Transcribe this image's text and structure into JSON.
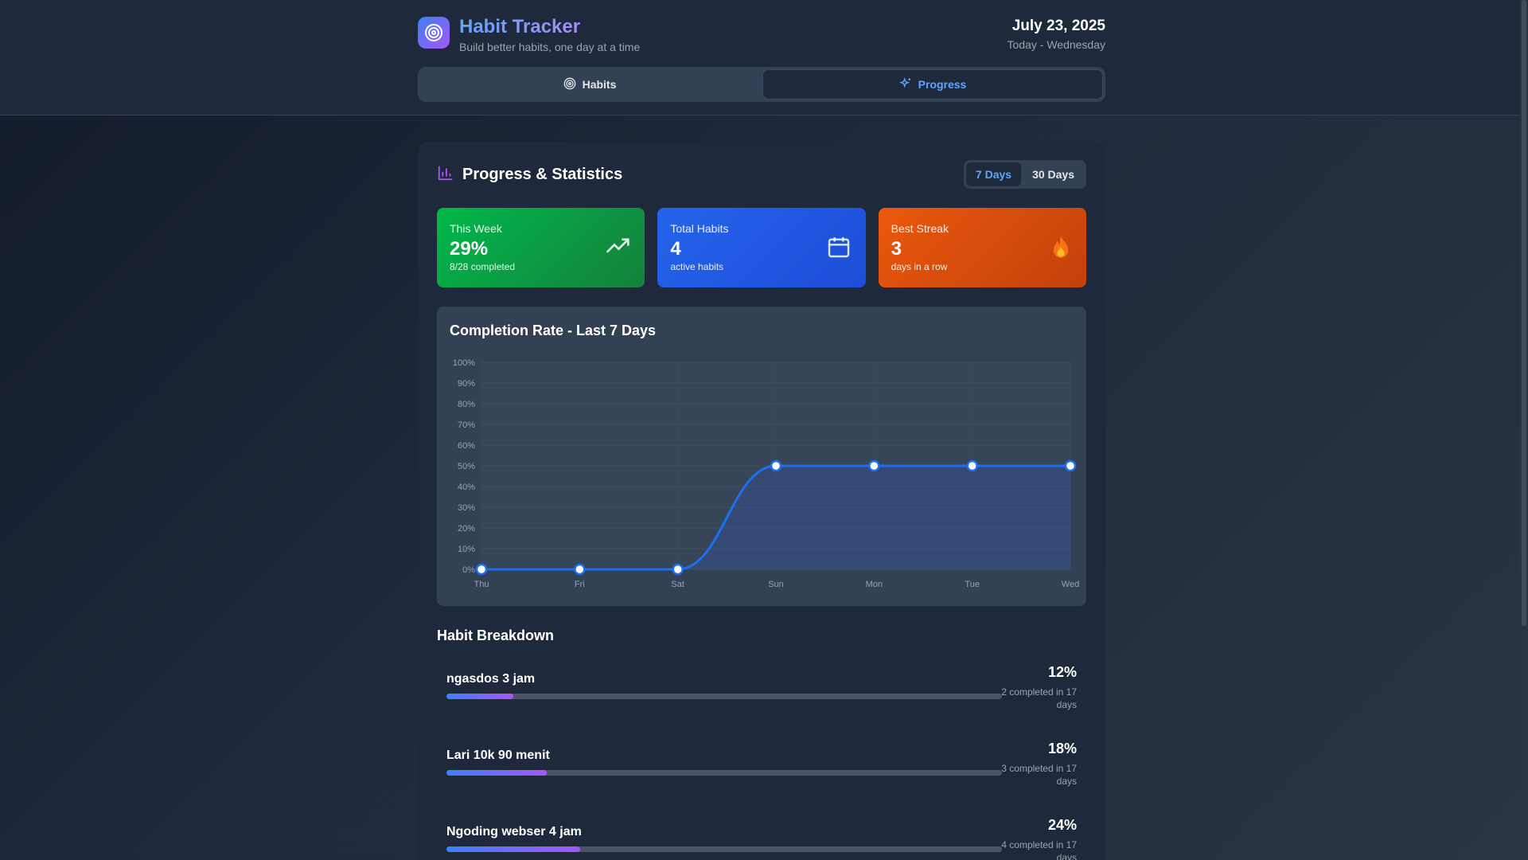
{
  "app": {
    "title": "Habit Tracker",
    "subtitle": "Build better habits, one day at a time",
    "date": "July 23, 2025",
    "date_sub": "Today - Wednesday"
  },
  "tabs": [
    {
      "label": "Habits",
      "icon": "target-icon",
      "active": false
    },
    {
      "label": "Progress",
      "icon": "sparkles-icon",
      "active": true
    }
  ],
  "panel": {
    "title": "Progress & Statistics",
    "range_options": [
      {
        "label": "7 Days",
        "active": true
      },
      {
        "label": "30 Days",
        "active": false
      }
    ]
  },
  "cards": [
    {
      "label": "This Week",
      "value": "29%",
      "sub": "8/28 completed",
      "icon": "trending-up-icon",
      "color": "#16a34a"
    },
    {
      "label": "Total Habits",
      "value": "4",
      "sub": "active habits",
      "icon": "calendar-icon",
      "color": "#2563eb"
    },
    {
      "label": "Best Streak",
      "value": "3",
      "sub": "days in a row",
      "icon": "fire-icon",
      "color": "#ea580c"
    }
  ],
  "chart_data": {
    "type": "line",
    "title": "Completion Rate - Last 7 Days",
    "categories": [
      "Thu",
      "Fri",
      "Sat",
      "Sun",
      "Mon",
      "Tue",
      "Wed"
    ],
    "values": [
      0,
      0,
      0,
      50,
      50,
      50,
      50
    ],
    "y_ticks": [
      "0%",
      "10%",
      "20%",
      "30%",
      "40%",
      "50%",
      "60%",
      "70%",
      "80%",
      "90%",
      "100%"
    ],
    "ylim": [
      0,
      100
    ],
    "grid": true,
    "area_fill": true,
    "line_color": "#1d6ff2"
  },
  "breakdown": {
    "title": "Habit Breakdown",
    "items": [
      {
        "name": "ngasdos 3 jam",
        "percent": "12%",
        "fraction": 0.12,
        "detail": "2 completed in 17 days"
      },
      {
        "name": "Lari 10k 90 menit",
        "percent": "18%",
        "fraction": 0.18,
        "detail": "3 completed in 17 days"
      },
      {
        "name": "Ngoding webser 4 jam",
        "percent": "24%",
        "fraction": 0.24,
        "detail": "4 completed in 17 days"
      }
    ]
  }
}
